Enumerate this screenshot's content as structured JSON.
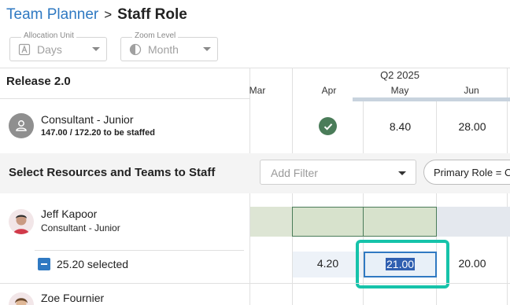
{
  "breadcrumb": {
    "parent": "Team Planner",
    "separator": ">",
    "current": "Staff Role"
  },
  "allocation_unit": {
    "label": "Allocation Unit",
    "value": "Days",
    "icon": "letter-a-icon"
  },
  "zoom_level": {
    "label": "Zoom Level",
    "value": "Month",
    "icon": "half-circle-icon"
  },
  "release": {
    "title": "Release 2.0"
  },
  "timeline": {
    "quarter": "Q2 2025",
    "months": [
      "Mar",
      "Apr",
      "May",
      "Jun"
    ]
  },
  "role": {
    "title": "Consultant - Junior",
    "subtitle": "147.00 / 172.20 to be staffed",
    "may_value": "8.40",
    "jun_value": "28.00",
    "apr_status_icon": "check-circle-icon"
  },
  "section": {
    "title": "Select Resources and Teams to Staff",
    "filter_placeholder": "Add Filter",
    "chip_label": "Primary Role = C"
  },
  "resources": [
    {
      "name": "Jeff Kapoor",
      "role": "Consultant - Junior",
      "selected_text": "25.20 selected",
      "apr_value": "4.20",
      "may_value": "21.00",
      "jun_value": "20.00"
    },
    {
      "name": "Zoe Fournier"
    }
  ],
  "colors": {
    "link": "#2f79c2",
    "success": "#4a7c59",
    "highlight": "#16c3aa",
    "allocation_green": "#dde5d4"
  }
}
